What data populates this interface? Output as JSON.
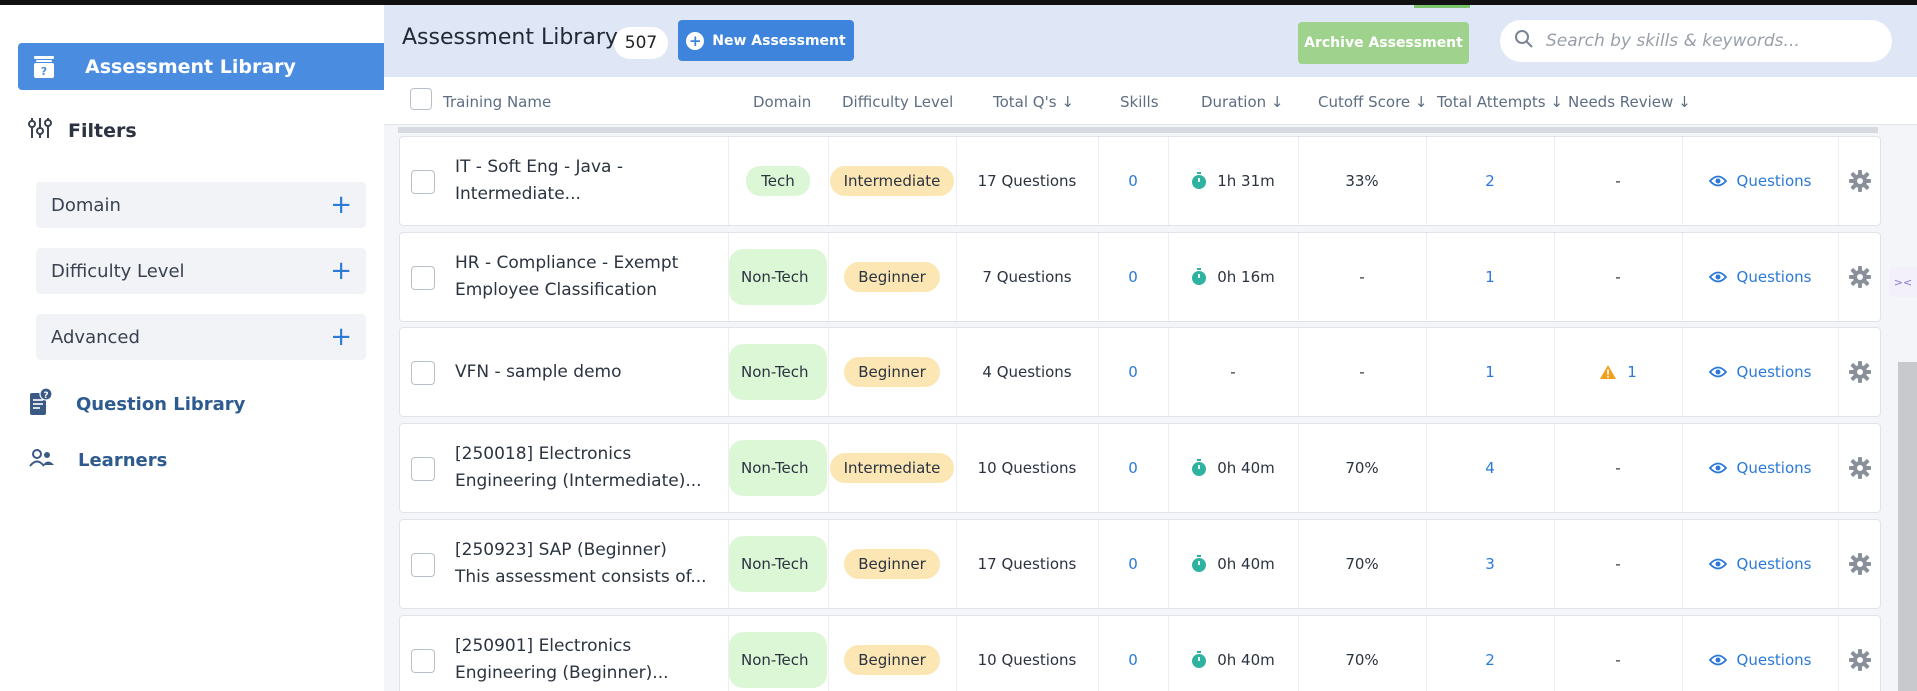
{
  "sidebar": {
    "active_item": "Assessment Library",
    "filters_label": "Filters",
    "filter_groups": [
      {
        "label": "Domain"
      },
      {
        "label": "Difficulty Level"
      },
      {
        "label": "Advanced"
      }
    ],
    "plus_symbol": "+",
    "links": [
      {
        "label": "Question Library",
        "icon": "question-book-icon"
      },
      {
        "label": "Learners",
        "icon": "users-icon"
      }
    ]
  },
  "header": {
    "title": "Assessment Library",
    "count": "507",
    "new_button": "New Assessment",
    "archive_button": "Archive Assessment",
    "search_placeholder": "Search by skills & keywords..."
  },
  "columns": {
    "training_name": "Training Name",
    "domain": "Domain",
    "difficulty": "Difficulty Level",
    "total_qs": "Total Q's ↓",
    "skills": "Skills",
    "duration": "Duration ↓",
    "cutoff": "Cutoff Score ↓",
    "attempts": "Total Attempts ↓",
    "needs_review": "Needs Review ↓"
  },
  "rows": [
    {
      "name_line1": "IT - Soft Eng - Java -",
      "name_line2": "Intermediate...",
      "domain": "Tech",
      "difficulty": "Intermediate",
      "questions": "17 Questions",
      "skills": "0",
      "duration": "1h 31m",
      "cutoff": "33%",
      "attempts": "2",
      "review": "-",
      "review_warning": false,
      "action": "Questions"
    },
    {
      "name_line1": "HR - Compliance - Exempt",
      "name_line2": "Employee Classification",
      "domain": "Non-Tech",
      "difficulty": "Beginner",
      "questions": "7 Questions",
      "skills": "0",
      "duration": "0h 16m",
      "cutoff": "-",
      "attempts": "1",
      "review": "-",
      "review_warning": false,
      "action": "Questions"
    },
    {
      "name_line1": "VFN - sample demo",
      "name_line2": "",
      "domain": "Non-Tech",
      "difficulty": "Beginner",
      "questions": "4 Questions",
      "skills": "0",
      "duration": "-",
      "cutoff": "-",
      "attempts": "1",
      "review": "1",
      "review_warning": true,
      "action": "Questions"
    },
    {
      "name_line1": "[250018] Electronics",
      "name_line2": "Engineering (Intermediate)...",
      "domain": "Non-Tech",
      "difficulty": "Intermediate",
      "questions": "10 Questions",
      "skills": "0",
      "duration": "0h 40m",
      "cutoff": "70%",
      "attempts": "4",
      "review": "-",
      "review_warning": false,
      "action": "Questions"
    },
    {
      "name_line1": "[250923] SAP (Beginner)",
      "name_line2": "This assessment consists of...",
      "domain": "Non-Tech",
      "difficulty": "Beginner",
      "questions": "17 Questions",
      "skills": "0",
      "duration": "0h 40m",
      "cutoff": "70%",
      "attempts": "3",
      "review": "-",
      "review_warning": false,
      "action": "Questions"
    },
    {
      "name_line1": "[250901] Electronics",
      "name_line2": "Engineering (Beginner)...",
      "domain": "Non-Tech",
      "difficulty": "Beginner",
      "questions": "10 Questions",
      "skills": "0",
      "duration": "0h 40m",
      "cutoff": "70%",
      "attempts": "2",
      "review": "-",
      "review_warning": false,
      "action": "Questions"
    }
  ],
  "colors": {
    "accent": "#4a8de0",
    "archive": "#9fd38d",
    "domain_pill": "#dcf7d6",
    "difficulty_pill": "#fbe6b4",
    "link": "#2b7ad8",
    "warning": "#f0a020"
  }
}
